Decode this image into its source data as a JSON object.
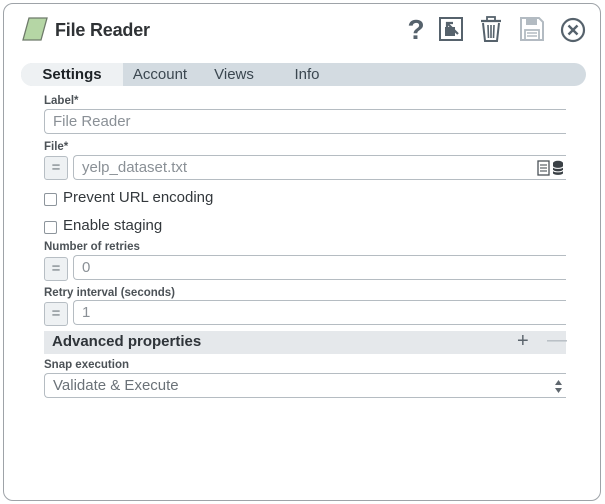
{
  "window": {
    "title": "File Reader",
    "icons": [
      "help-icon",
      "export-icon",
      "delete-icon",
      "save-icon",
      "close-icon"
    ],
    "colors": {
      "snap_icon_fill": "#b5d6a5",
      "accent": "#d3dbe1"
    }
  },
  "tabs": [
    {
      "label": "Settings",
      "active": true
    },
    {
      "label": "Account",
      "active": false
    },
    {
      "label": "Views",
      "active": false
    },
    {
      "label": "Info",
      "active": false
    }
  ],
  "fields": {
    "label": {
      "label": "Label*",
      "value": "File Reader"
    },
    "file": {
      "label": "File*",
      "value": "yelp_dataset.txt",
      "expr": "="
    },
    "prevent_url_encoding": {
      "label": "Prevent URL encoding",
      "checked": false
    },
    "enable_staging": {
      "label": "Enable staging",
      "checked": false
    },
    "retries": {
      "label": "Number of retries",
      "value": "0",
      "expr": "="
    },
    "retry_interval": {
      "label": "Retry interval (seconds)",
      "value": "1",
      "expr": "="
    }
  },
  "advanced": {
    "title": "Advanced properties",
    "add": "+",
    "remove": "—",
    "snap_execution": {
      "label": "Snap execution",
      "value": "Validate & Execute"
    }
  }
}
